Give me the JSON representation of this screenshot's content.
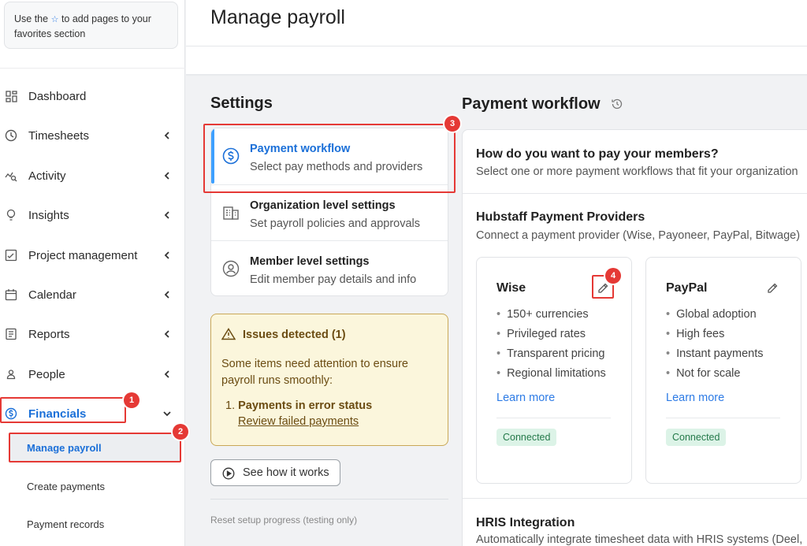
{
  "sidebar": {
    "favorites_tip_before": "Use the",
    "favorites_tip_after": "to add pages to your favorites section",
    "items": [
      {
        "label": "Dashboard",
        "icon": "dashboard-icon"
      },
      {
        "label": "Timesheets",
        "icon": "clock-icon"
      },
      {
        "label": "Activity",
        "icon": "activity-icon"
      },
      {
        "label": "Insights",
        "icon": "lightbulb-icon"
      },
      {
        "label": "Project management",
        "icon": "checklist-icon"
      },
      {
        "label": "Calendar",
        "icon": "calendar-icon"
      },
      {
        "label": "Reports",
        "icon": "report-icon"
      },
      {
        "label": "People",
        "icon": "person-icon"
      },
      {
        "label": "Financials",
        "icon": "dollar-circle-icon"
      }
    ],
    "sub_items": [
      {
        "label": "Manage payroll"
      },
      {
        "label": "Create payments"
      },
      {
        "label": "Payment records"
      }
    ]
  },
  "header": {
    "title": "Manage payroll"
  },
  "settings": {
    "title": "Settings",
    "items": [
      {
        "title": "Payment workflow",
        "desc": "Select pay methods and providers"
      },
      {
        "title": "Organization level settings",
        "desc": "Set payroll policies and approvals"
      },
      {
        "title": "Member level settings",
        "desc": "Edit member pay details and info"
      }
    ],
    "issues": {
      "title": "Issues detected (1)",
      "text": "Some items need attention to ensure payroll runs smoothly:",
      "item_number": "1.",
      "item": "Payments in error status",
      "link": "Review failed payments"
    },
    "see_how": "See how it works",
    "reset": "Reset setup progress (testing only)"
  },
  "workflow": {
    "title": "Payment workflow",
    "question": "How do you want to pay your members?",
    "question_sub": "Select one or more payment workflows that fit your organization",
    "providers_title": "Hubstaff Payment Providers",
    "providers_sub": "Connect a payment provider (Wise, Payoneer, PayPal, Bitwage)",
    "providers": [
      {
        "name": "Wise",
        "features": [
          "150+ currencies",
          "Privileged rates",
          "Transparent pricing",
          "Regional limitations"
        ],
        "link": "Learn more",
        "status": "Connected"
      },
      {
        "name": "PayPal",
        "features": [
          "Global adoption",
          "High fees",
          "Instant payments",
          "Not for scale"
        ],
        "link": "Learn more",
        "status": "Connected"
      }
    ],
    "hris_title": "HRIS Integration",
    "hris_sub": "Automatically integrate timesheet data with HRIS systems (Deel,"
  },
  "callouts": [
    "1",
    "2",
    "3",
    "4"
  ],
  "colors": {
    "accent": "#1a6fd8",
    "callout": "#e53935",
    "warning_bg": "#fbf6dc",
    "badge_bg": "#dcf3e7"
  }
}
